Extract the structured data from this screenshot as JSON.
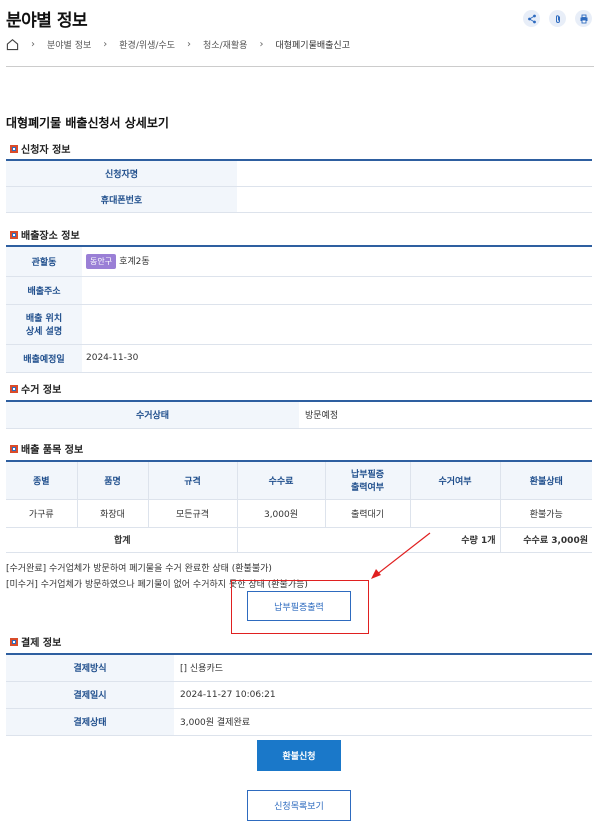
{
  "page": {
    "title": "분야별 정보"
  },
  "breadcrumb": [
    "분야별 정보",
    "환경/위생/수도",
    "청소/재활용",
    "대형폐기물배출신고"
  ],
  "doc_title": "대형폐기물 배출신청서 상세보기",
  "applicant": {
    "section": "신청자 정보",
    "name_label": "신청자명",
    "phone_label": "휴대폰번호"
  },
  "location": {
    "section": "배출장소 정보",
    "district_label": "관할동",
    "district_badge": "동안구",
    "district_value": "호계2동",
    "address_label": "배출주소",
    "detail_label_1": "배출 위치",
    "detail_label_2": "상세 설명",
    "date_label": "배출예정일",
    "date_value": "2024-11-30"
  },
  "collection": {
    "section": "수거 정보",
    "status_label": "수거상태",
    "status_value": "방문예정"
  },
  "items": {
    "section": "배출 품목 정보",
    "headers": [
      "종별",
      "품명",
      "규격",
      "수수료",
      "납부필증 출력여부",
      "수거여부",
      "환불상태"
    ],
    "header_output_1": "납부필증",
    "header_output_2": "출력여부",
    "row": [
      "가구류",
      "화장대",
      "모든규격",
      "3,000원",
      "출력대기",
      "",
      "환불가능"
    ],
    "total_label": "합계",
    "total_qty": "수량 1개",
    "total_fee": "수수료 3,000원"
  },
  "notes": {
    "line1": "[수거완료] 수거업체가 방문하여 폐기물을 수거 완료한 상태 (환불불가)",
    "line2": "[미수거] 수거업체가 방문하였으나 폐기물이 없어 수거하지 못한 상태 (환불가능)"
  },
  "buttons": {
    "print_receipt": "납부필증출력",
    "refund": "환불신청",
    "list": "신청목록보기"
  },
  "payment": {
    "section": "결제 정보",
    "method_label": "결제방식",
    "method_value": "[] 신용카드",
    "date_label": "결제일시",
    "date_value": "2024-11-27 10:06:21",
    "status_label": "결제상태",
    "status_value": "3,000원 결제완료"
  },
  "colors": {
    "accent": "#2e5fa0",
    "button": "#1a78c9",
    "highlight": "#e02020",
    "badge": "#9a7fd6"
  }
}
